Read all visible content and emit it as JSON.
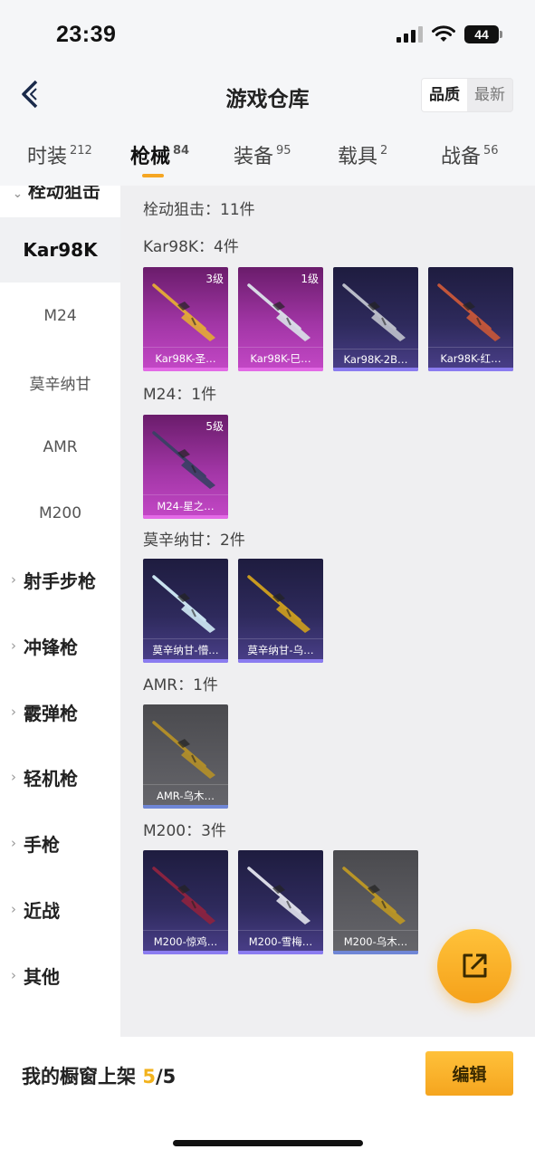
{
  "status": {
    "time": "23:39",
    "battery": "44"
  },
  "header": {
    "title": "游戏仓库",
    "sort_options": [
      "品质",
      "最新"
    ]
  },
  "tabs": [
    {
      "label": "时装",
      "count": "212"
    },
    {
      "label": "枪械",
      "count": "84"
    },
    {
      "label": "装备",
      "count": "95"
    },
    {
      "label": "载具",
      "count": "2"
    },
    {
      "label": "战备",
      "count": "56"
    }
  ],
  "sidebar": {
    "partial_label": "栓动狙击",
    "items": [
      "Kar98K",
      "M24",
      "莫辛纳甘",
      "AMR",
      "M200"
    ],
    "categories": [
      "射手步枪",
      "冲锋枪",
      "霰弹枪",
      "轻机枪",
      "手枪",
      "近战",
      "其他"
    ]
  },
  "content": {
    "summary": "栓动狙击：11件",
    "sections": [
      {
        "title": "Kar98K：4件",
        "cards": [
          {
            "name": "Kar98K-圣…",
            "level": "3级",
            "rarity": "pink",
            "gun_color": "#e0a53a"
          },
          {
            "name": "Kar98K-巳…",
            "level": "1级",
            "rarity": "pink",
            "gun_color": "#d8dbe6"
          },
          {
            "name": "Kar98K-2B…",
            "level": "",
            "rarity": "purple",
            "gun_color": "#b9bcc8"
          },
          {
            "name": "Kar98K-红…",
            "level": "",
            "rarity": "purple",
            "gun_color": "#c2553a"
          }
        ]
      },
      {
        "title": "M24：1件",
        "cards": [
          {
            "name": "M24-星之…",
            "level": "5级",
            "rarity": "pink",
            "gun_color": "#3d3f66"
          }
        ]
      },
      {
        "title": "莫辛纳甘：2件",
        "cards": [
          {
            "name": "莫辛纳甘-懵…",
            "level": "",
            "rarity": "purple",
            "gun_color": "#c9e2ef"
          },
          {
            "name": "莫辛纳甘-乌…",
            "level": "",
            "rarity": "purple",
            "gun_color": "#c89a20"
          }
        ]
      },
      {
        "title": "AMR：1件",
        "cards": [
          {
            "name": "AMR-乌木…",
            "level": "",
            "rarity": "grey",
            "gun_color": "#b08d2a"
          }
        ]
      },
      {
        "title": "M200：3件",
        "cards": [
          {
            "name": "M200-惊鸡…",
            "level": "",
            "rarity": "purple",
            "gun_color": "#8a2340"
          },
          {
            "name": "M200-雪梅…",
            "level": "",
            "rarity": "purple",
            "gun_color": "#d9dae6"
          },
          {
            "name": "M200-乌木…",
            "level": "",
            "rarity": "grey",
            "gun_color": "#b99526"
          }
        ]
      }
    ]
  },
  "bottom": {
    "label": "我的橱窗上架",
    "count_current": "5",
    "count_total": "/5",
    "edit_label": "编辑"
  }
}
